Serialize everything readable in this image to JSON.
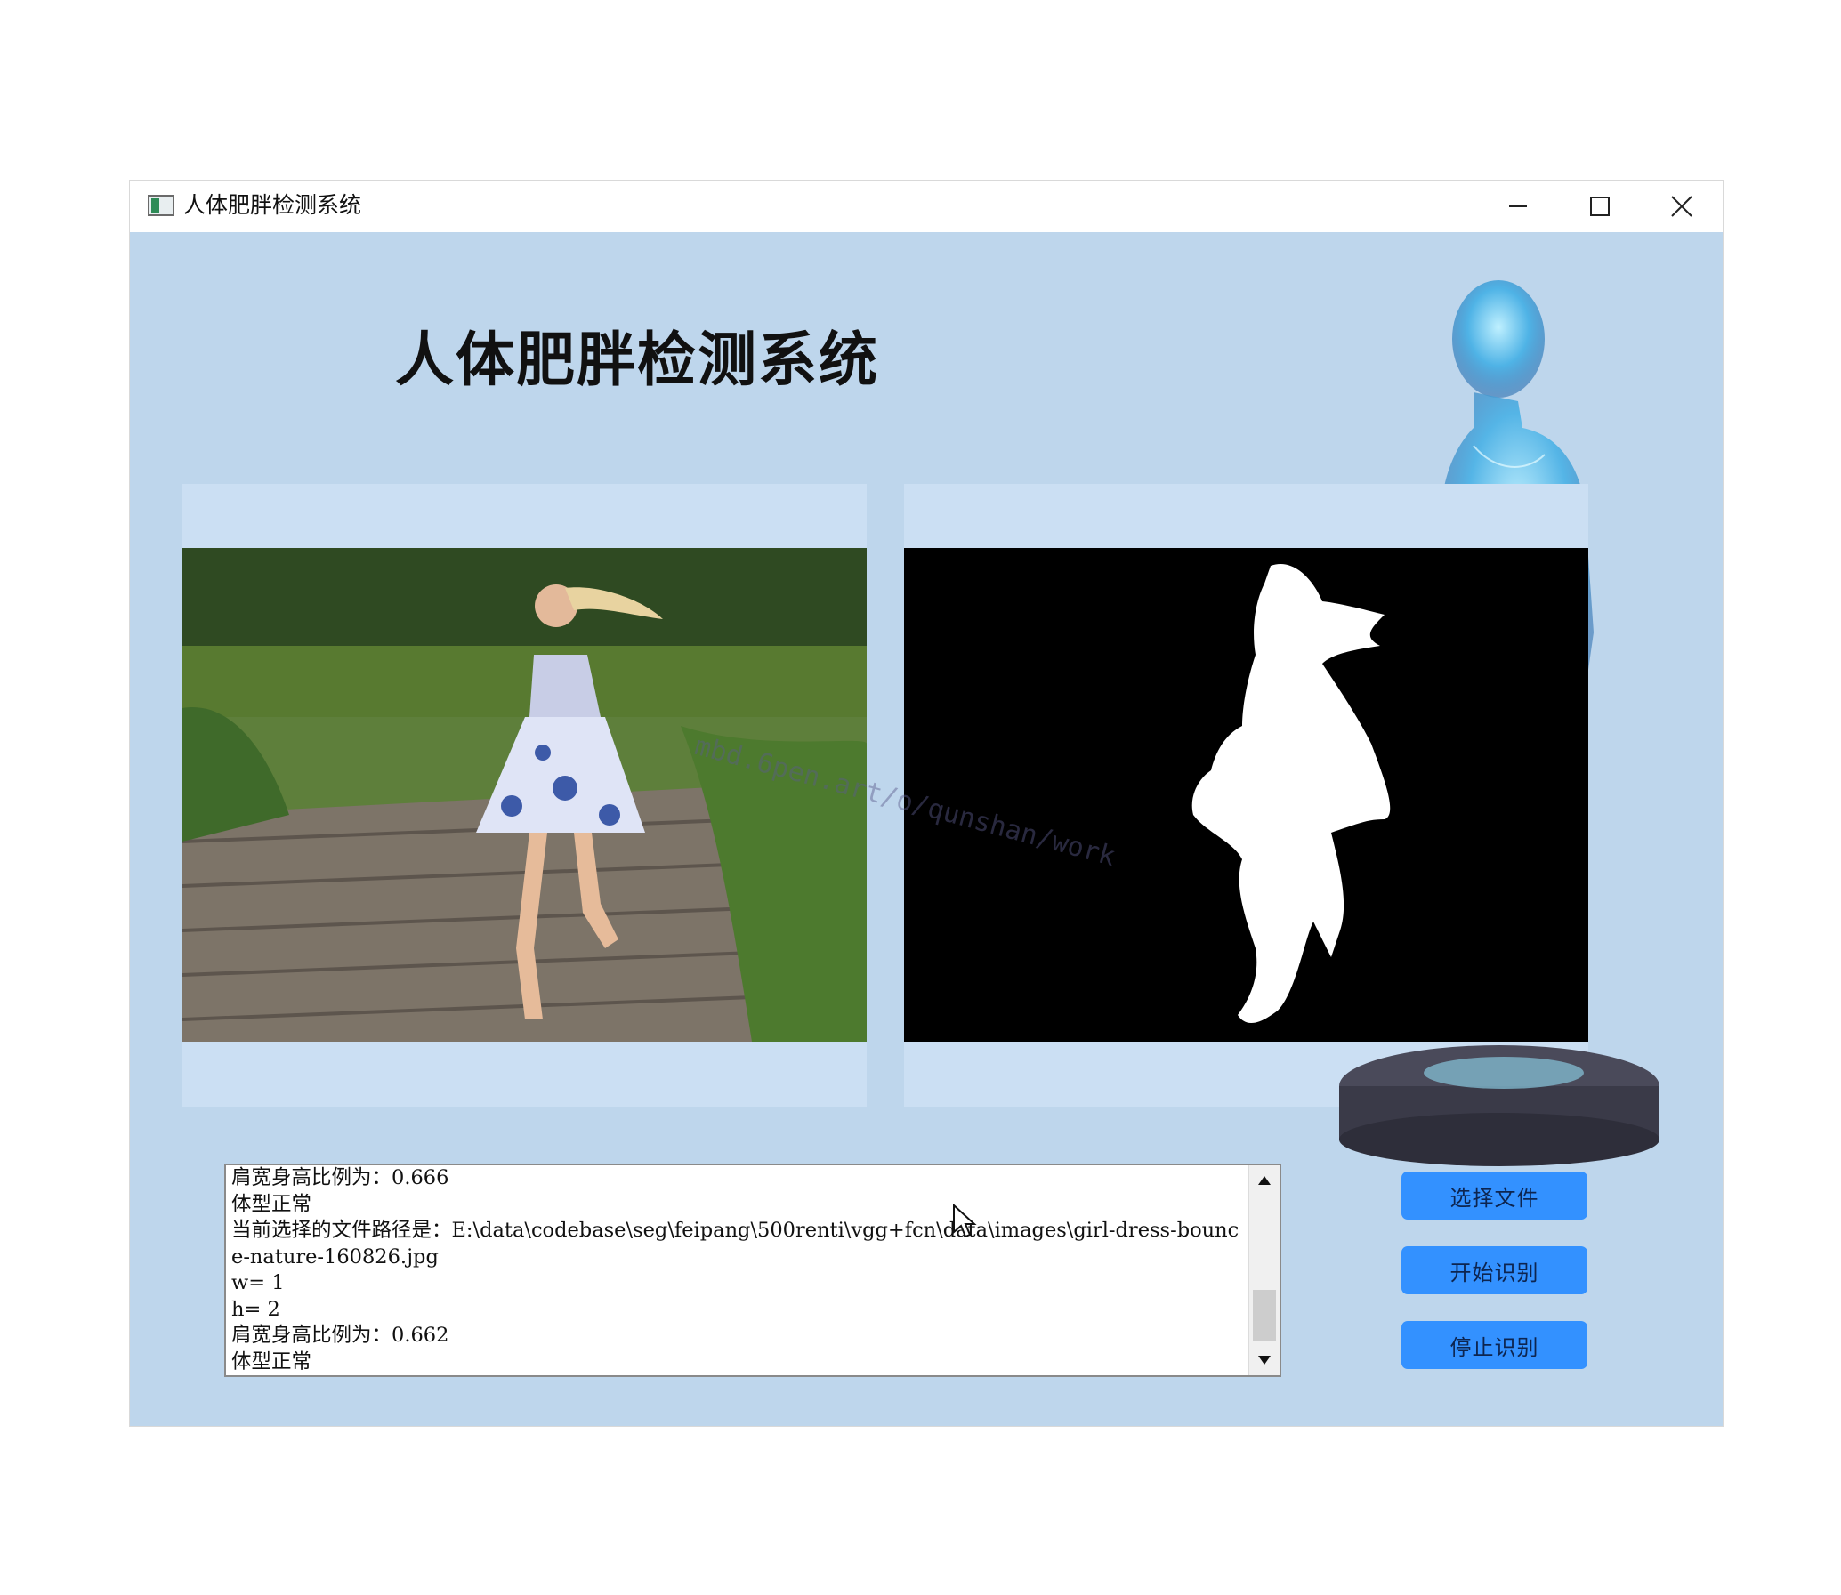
{
  "window": {
    "title": "人体肥胖检测系统",
    "minimize_glyph": "—",
    "maximize_glyph": "☐",
    "close_glyph": "✕"
  },
  "heading": "人体肥胖检测系统",
  "watermark": "mbd.6pen.art/o/qunshan/work",
  "log": {
    "lines": [
      "肩宽身高比例为：0.666",
      "体型正常",
      "当前选择的文件路径是：E:\\data\\codebase\\seg\\feipang\\500renti\\vgg+fcn\\data\\images\\girl-dress-bounce-nature-160826.jpg",
      "w= 1",
      "h= 2",
      "肩宽身高比例为：0.662",
      "体型正常"
    ]
  },
  "buttons": {
    "select_file": "选择文件",
    "start": "开始识别",
    "stop": "停止识别"
  },
  "icons": {
    "app": "app-window-icon",
    "scroll_up": "triangle-up-icon",
    "scroll_down": "triangle-down-icon"
  },
  "colors": {
    "client_bg": "#bed6ec",
    "panel_bg": "#cbdff3",
    "button_bg": "#3391ff"
  }
}
